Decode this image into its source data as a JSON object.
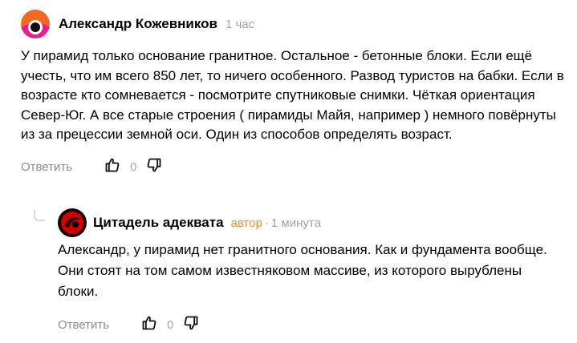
{
  "comments": [
    {
      "author": "Александр Кожевников",
      "time": "1 час",
      "text": "У пирамид только основание гранитное. Остальное - бетонные блоки. Если ещё учесть, что им всего 850 лет, то ничего особенного. Развод туристов на бабки. Если в возрасте кто сомневается - посмотрите спутниковые снимки. Чёткая ориентация Север-Юг. А все старые строения ( пирамиды Майя, например ) немного повёрнуты из за прецессии земной оси. Один из способов определять возраст.",
      "reply_label": "Ответить",
      "likes": "0"
    },
    {
      "author": "Цитадель адеквата",
      "tag": "автор",
      "separator": "·",
      "time": "1 минута",
      "text": "Александр, у пирамид нет гранитного основания. Как и фундамента вообще. Они стоят на том самом известняковом массиве, из которого вырублены блоки.",
      "reply_label": "Ответить",
      "likes": "0"
    }
  ],
  "colors": {
    "author_tag": "#f38b2b",
    "muted": "#8d8d8d",
    "avatar1_orange": "#f26a21",
    "avatar1_pink": "#e91e8c",
    "avatar2_red": "#d40000"
  },
  "icons": [
    "thumbs-up-icon",
    "thumbs-down-icon",
    "reply-thread-icon"
  ]
}
